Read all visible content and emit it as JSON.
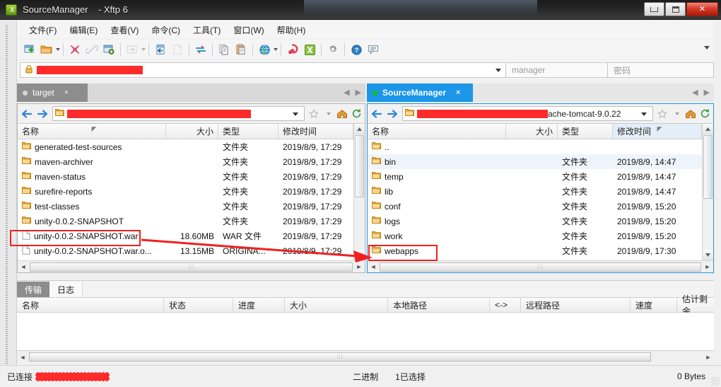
{
  "window": {
    "title": "SourceManager    - Xftp 6",
    "app_icon": "xftp-icon",
    "minimize": "minimize",
    "maximize": "maximize",
    "close": "✕"
  },
  "menubar": {
    "items": [
      {
        "label": "文件(F)"
      },
      {
        "label": "编辑(E)"
      },
      {
        "label": "查看(V)"
      },
      {
        "label": "命令(C)"
      },
      {
        "label": "工具(T)"
      },
      {
        "label": "窗口(W)"
      },
      {
        "label": "帮助(H)"
      }
    ]
  },
  "toolbar": {
    "icons": [
      "new-session-icon",
      "open-folder-icon",
      "open-folder-dropdown-icon",
      "disconnect-icon",
      "link-icon",
      "new-folder-icon",
      "transfer-mode-icon",
      "transfer-mode-dropdown-icon",
      "upload-icon",
      "download-icon",
      "sync-browse-icon",
      "copy-icon",
      "paste-icon",
      "globe-icon",
      "globe-dropdown-icon",
      "xshell-icon",
      "xftp-icon-small",
      "settings-gear-icon",
      "help-icon",
      "feedback-icon",
      "toolbar-overflow-icon"
    ]
  },
  "session_bar": {
    "address_redacted": true,
    "username_placeholder": "manager",
    "password_placeholder": "密码"
  },
  "tabs": {
    "left": {
      "label": "target",
      "close": "×",
      "active": false,
      "dot": "status-dot"
    },
    "right": {
      "label": "SourceManager",
      "close": "×",
      "active": true,
      "dot": "status-dot"
    },
    "nav_prev": "◀",
    "nav_next": "▶"
  },
  "left_panel": {
    "path_text": "",
    "path_redacted": true,
    "columns": [
      "名称",
      "大小",
      "类型",
      "修改时间"
    ],
    "rows": [
      {
        "name": "generated-test-sources",
        "size": "",
        "type": "文件夹",
        "modified": "2019/8/9, 17:29",
        "kind": "folder"
      },
      {
        "name": "maven-archiver",
        "size": "",
        "type": "文件夹",
        "modified": "2019/8/9, 17:29",
        "kind": "folder"
      },
      {
        "name": "maven-status",
        "size": "",
        "type": "文件夹",
        "modified": "2019/8/9, 17:29",
        "kind": "folder"
      },
      {
        "name": "surefire-reports",
        "size": "",
        "type": "文件夹",
        "modified": "2019/8/9, 17:29",
        "kind": "folder"
      },
      {
        "name": "test-classes",
        "size": "",
        "type": "文件夹",
        "modified": "2019/8/9, 17:29",
        "kind": "folder"
      },
      {
        "name": "unity-0.0.2-SNAPSHOT",
        "size": "",
        "type": "文件夹",
        "modified": "2019/8/9, 17:29",
        "kind": "folder"
      },
      {
        "name": "unity-0.0.2-SNAPSHOT.war",
        "size": "18.60MB",
        "type": "WAR 文件",
        "modified": "2019/8/9, 17:29",
        "kind": "file"
      },
      {
        "name": "unity-0.0.2-SNAPSHOT.war.o...",
        "size": "13.15MB",
        "type": "ORIGINA...",
        "modified": "2019/8/9, 17:29",
        "kind": "file"
      }
    ],
    "hscroll_grip": "⦙⦙⦙"
  },
  "right_panel": {
    "path_text": "ache-tomcat-9.0.22",
    "path_redacted": true,
    "columns": [
      "名称",
      "大小",
      "类型",
      "修改时间"
    ],
    "rows": [
      {
        "name": "..",
        "size": "",
        "type": "",
        "modified": "",
        "kind": "folder"
      },
      {
        "name": "bin",
        "size": "",
        "type": "文件夹",
        "modified": "2019/8/9, 14:47",
        "kind": "folder"
      },
      {
        "name": "temp",
        "size": "",
        "type": "文件夹",
        "modified": "2019/8/9, 14:47",
        "kind": "folder"
      },
      {
        "name": "lib",
        "size": "",
        "type": "文件夹",
        "modified": "2019/8/9, 14:47",
        "kind": "folder"
      },
      {
        "name": "conf",
        "size": "",
        "type": "文件夹",
        "modified": "2019/8/9, 15:20",
        "kind": "folder"
      },
      {
        "name": "logs",
        "size": "",
        "type": "文件夹",
        "modified": "2019/8/9, 15:20",
        "kind": "folder"
      },
      {
        "name": "work",
        "size": "",
        "type": "文件夹",
        "modified": "2019/8/9, 15:20",
        "kind": "folder"
      },
      {
        "name": "webapps",
        "size": "",
        "type": "文件夹",
        "modified": "2019/8/9, 17:30",
        "kind": "folder"
      }
    ],
    "hscroll_grip": "⦙⦙⦙"
  },
  "transfer": {
    "tabs": [
      {
        "label": "传输",
        "active": true
      },
      {
        "label": "日志",
        "active": false
      }
    ],
    "columns": [
      "名称",
      "状态",
      "进度",
      "大小",
      "本地路径",
      "<->",
      "远程路径",
      "速度",
      "估计剩余.."
    ],
    "rows": [],
    "hscroll_grip": "⦙⦙⦙"
  },
  "statusbar": {
    "connected_label": "已连接",
    "host_redacted": true,
    "mode": "二进制",
    "selection": "1已选择",
    "bytes": "0 Bytes"
  },
  "colors": {
    "accent": "#1b96e8",
    "annotation": "#ef2020",
    "redaction": "#fe2b2b",
    "tab_inactive": "#8d8d8d",
    "title_bg": "#242424",
    "close_red": "#c0341f"
  }
}
